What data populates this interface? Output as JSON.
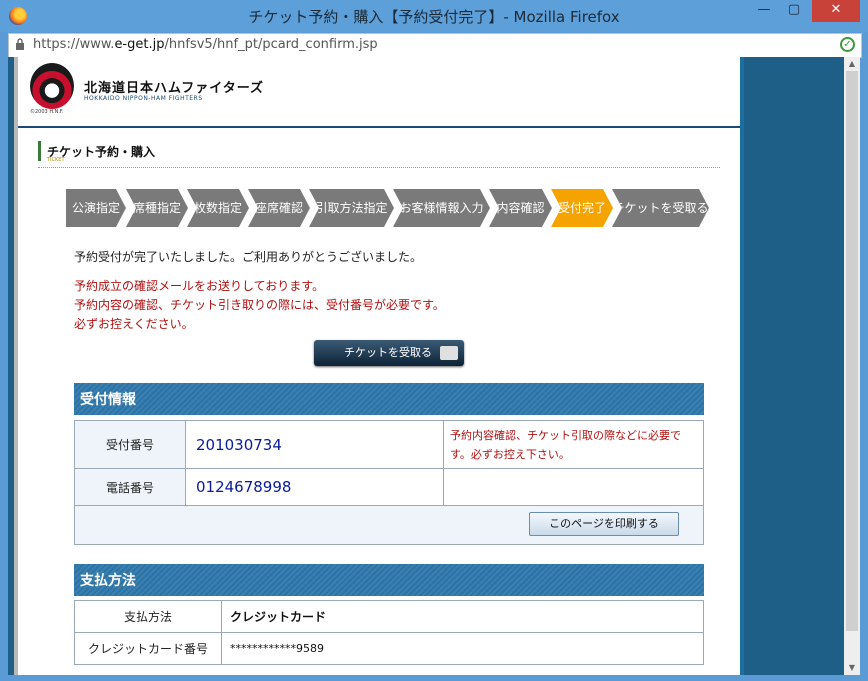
{
  "window": {
    "title": "チケット予約・購入【予約受付完了】- Mozilla Firefox",
    "minimize": "—",
    "maximize": "▢",
    "close": "✕"
  },
  "browser": {
    "url_prefix": "https://www.",
    "url_domain": "e-get.jp",
    "url_path": "/hnfsv5/hnf_pt/pcard_confirm.jsp"
  },
  "header": {
    "logo_caption": "©2003 H.N.F.",
    "brand": "北海道日本ハムファイターズ",
    "brand_sub": "HOKKAIDO NIPPON-HAM FIGHTERS"
  },
  "section": {
    "title": "チケット予約・購入",
    "sub": "TICKET"
  },
  "steps": [
    "公演指定",
    "席種指定",
    "枚数指定",
    "座席確認",
    "引取方法指定",
    "お客様情報入力",
    "内容確認",
    "受付完了",
    "チケットを受取る"
  ],
  "current_step": 7,
  "messages": {
    "complete": "予約受付が完了いたしました。ご利用ありがとうございました。",
    "red1": "予約成立の確認メールをお送りしております。",
    "red2": "予約内容の確認、チケット引き取りの際には、受付番号が必要です。",
    "red3": "必ずお控えください。"
  },
  "ticket_button": "チケットを受取る",
  "reception": {
    "heading": "受付情報",
    "number_label": "受付番号",
    "number": "201030734",
    "note": "予約内容確認、チケット引取の際などに必要です。必ずお控え下さい。",
    "phone_label": "電話番号",
    "phone": "0124678998",
    "print_button": "このページを印刷する"
  },
  "payment": {
    "heading": "支払方法",
    "method_label": "支払方法",
    "method": "クレジットカード",
    "card_label": "クレジットカード番号",
    "card_number": "************9589"
  }
}
